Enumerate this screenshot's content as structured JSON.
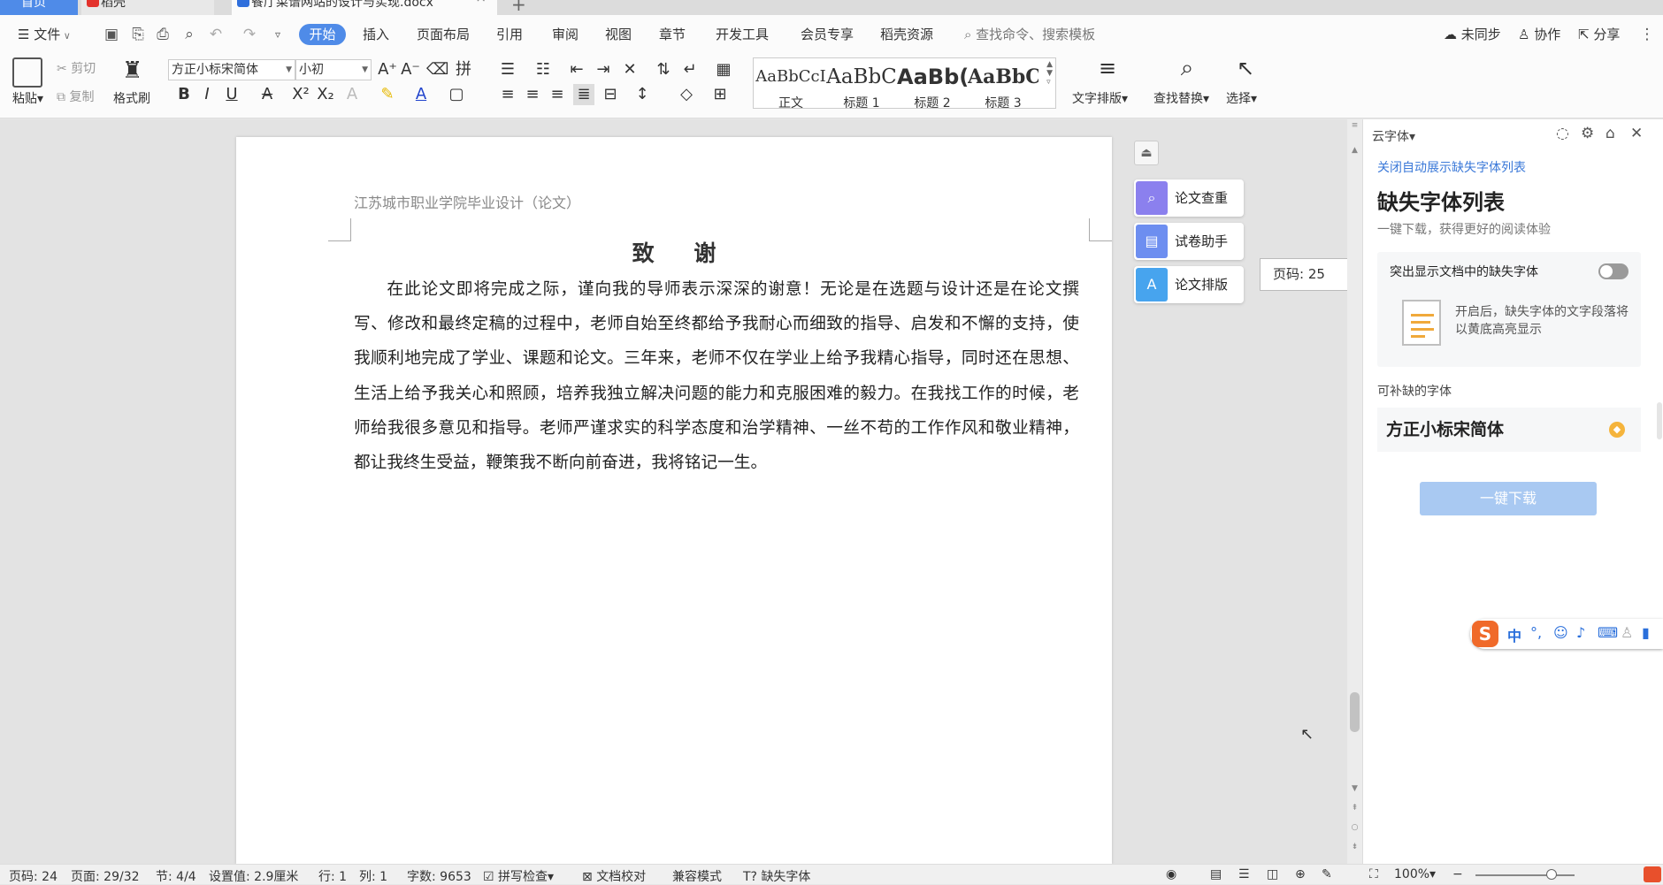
{
  "window_tabs": {
    "home": "首页",
    "daoke": "稻壳",
    "doc": "餐厅菜谱网站的设计与实现.docx"
  },
  "menu": {
    "file": "文件",
    "tabs": [
      "开始",
      "插入",
      "页面布局",
      "引用",
      "审阅",
      "视图",
      "章节",
      "开发工具",
      "会员专享",
      "稻壳资源"
    ],
    "search_placeholder": "查找命令、搜索模板",
    "sync": "未同步",
    "collab": "协作",
    "share": "分享"
  },
  "ribbon": {
    "paste": "粘贴",
    "cut": "剪切",
    "copy": "复制",
    "format_painter": "格式刷",
    "font_name": "方正小标宋简体",
    "font_size": "小初",
    "styles": [
      {
        "preview": "AaBbCcI",
        "name": "正文"
      },
      {
        "preview": "AaBbC",
        "name": "标题 1"
      },
      {
        "preview": "AaBb(",
        "name": "标题 2"
      },
      {
        "preview": "AaBbC",
        "name": "标题 3"
      }
    ],
    "text_layout": "文字排版",
    "find_replace": "查找替换",
    "select": "选择"
  },
  "document": {
    "header": "江苏城市职业学院毕业设计（论文）",
    "heading": "致 谢",
    "body": "在此论文即将完成之际，谨向我的导师表示深深的谢意！无论是在选题与设计还是在论文撰写、修改和最终定稿的过程中，老师自始至终都给予我耐心而细致的指导、启发和不懈的支持，使我顺利地完成了学业、课题和论文。三年来，老师不仅在学业上给予我精心指导，同时还在思想、生活上给予我关心和照顾，培养我独立解决问题的能力和克服困难的毅力。在我找工作的时候，老师给我很多意见和指导。老师严谨求实的科学态度和治学精神、一丝不苟的工作作风和敬业精神，都让我终生受益，鞭策我不断向前奋进，我将铭记一生。"
  },
  "float_tools": [
    "论文查重",
    "试卷助手",
    "论文排版"
  ],
  "page_indicator": "页码: 25",
  "panel": {
    "title": "云字体",
    "link": "关闭自动展示缺失字体列表",
    "heading": "缺失字体列表",
    "subtitle": "一键下载，获得更好的阅读体验",
    "highlight_label": "突出显示文档中的缺失字体",
    "highlight_on": false,
    "highlight_desc": "开启后，缺失字体的文字段落将以黄底高亮显示",
    "fixable_label": "可补缺的字体",
    "missing_font": "方正小标宋简体",
    "download_button": "一键下载"
  },
  "ime": {
    "mode": "中"
  },
  "status": {
    "page_no": "页码: 24",
    "pages": "页面: 29/32",
    "section": "节: 4/4",
    "setting": "设置值: 2.9厘米",
    "row": "行: 1",
    "col": "列: 1",
    "words": "字数: 9653",
    "spell": "拼写检查",
    "proof": "文档校对",
    "compat": "兼容模式",
    "missing_font": "缺失字体",
    "zoom": "100%"
  },
  "colors": {
    "accent": "#4f8be8",
    "link": "#3a78d8",
    "download_disabled": "#a9c9f2"
  }
}
